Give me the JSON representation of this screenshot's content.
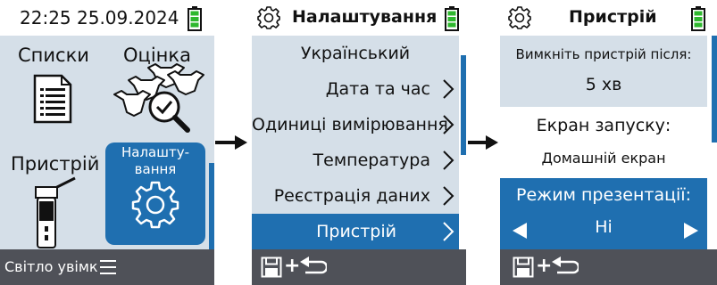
{
  "screen1": {
    "datetime": "22:25 25.09.2024",
    "tiles": {
      "lists": "Списки",
      "assessment": "Оцінка",
      "device": "Пристрій",
      "settings_line1": "Налашту-",
      "settings_line2": "вання"
    },
    "footer": {
      "light": "Світло увімк"
    }
  },
  "screen2": {
    "title": "Налаштування",
    "items": [
      {
        "label": "Український"
      },
      {
        "label": "Дата та час"
      },
      {
        "label": "Одиниці вимірювання"
      },
      {
        "label": "Температура"
      },
      {
        "label": "Реєстрація даних"
      },
      {
        "label": "Пристрій"
      }
    ]
  },
  "screen3": {
    "title": "Пристрій",
    "off_after_label": "Вимкніть пристрій після:",
    "off_after_value": "5 хв",
    "startup_label": "Екран запуску:",
    "startup_value": "Домашній екран",
    "presentation_label": "Режим презентації:",
    "presentation_value": "Ні"
  },
  "colors": {
    "accent": "#1f6fb0",
    "battery": "#2eb82e",
    "panel": "#d5dfe8",
    "footer": "#4f5158"
  },
  "icons": [
    "battery-icon",
    "gear-icon",
    "save-icon",
    "back-arrow-icon",
    "menu-icon",
    "chevron-right-icon",
    "triangle-left-icon",
    "triangle-right-icon"
  ]
}
